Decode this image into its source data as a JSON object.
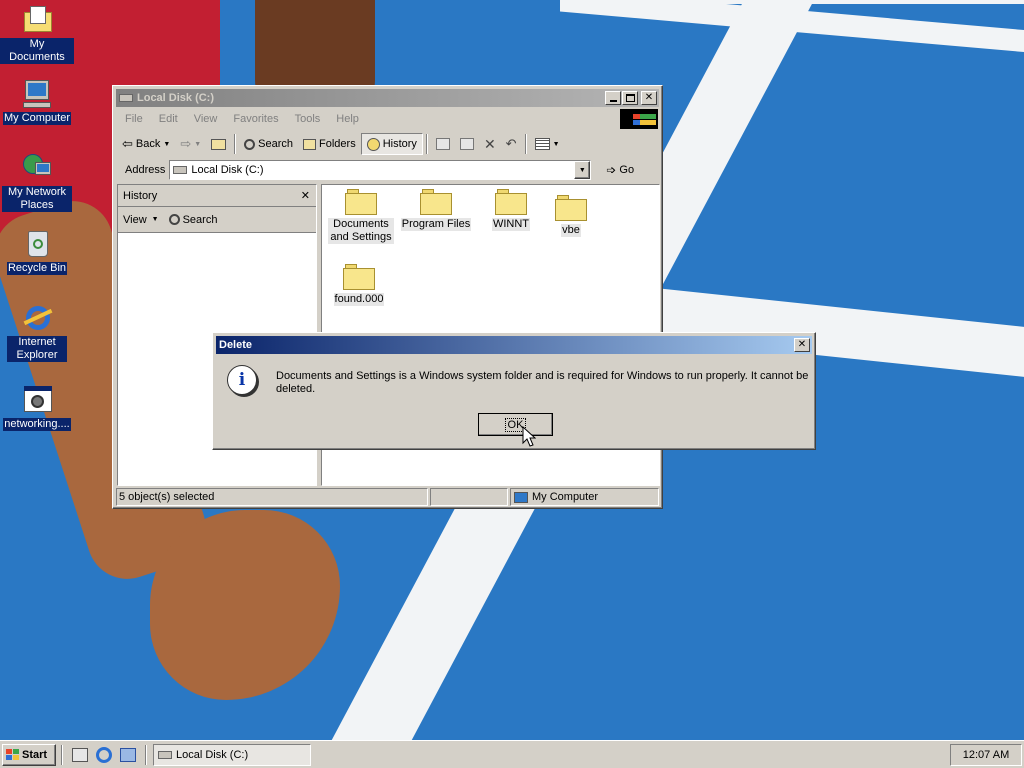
{
  "desktop": {
    "icons": [
      {
        "label": "My Documents",
        "icon": "my-documents-icon"
      },
      {
        "label": "My Computer",
        "icon": "my-computer-icon"
      },
      {
        "label": "My Network Places",
        "icon": "network-places-icon"
      },
      {
        "label": "Recycle Bin",
        "icon": "recycle-bin-icon"
      },
      {
        "label": "Internet Explorer",
        "icon": "internet-explorer-icon"
      },
      {
        "label": "networking....",
        "icon": "program-icon"
      }
    ]
  },
  "explorer": {
    "title": "Local Disk (C:)",
    "menu": [
      "File",
      "Edit",
      "View",
      "Favorites",
      "Tools",
      "Help"
    ],
    "toolbar": {
      "back": "Back",
      "search": "Search",
      "folders": "Folders",
      "history": "History"
    },
    "address": {
      "label": "Address",
      "value": "Local Disk (C:)",
      "go": "Go"
    },
    "history_pane": {
      "title": "History",
      "view": "View",
      "search": "Search"
    },
    "files": [
      {
        "name": "Documents and Settings"
      },
      {
        "name": "Program Files"
      },
      {
        "name": "WINNT"
      },
      {
        "name": "vbe"
      },
      {
        "name": "found.000"
      }
    ],
    "status": {
      "selection": "5 object(s) selected",
      "zone": "My Computer"
    }
  },
  "dialog": {
    "title": "Delete",
    "message": "Documents and Settings is a Windows system folder and is required for Windows to run properly. It cannot be deleted.",
    "ok": "OK",
    "icon": "info-icon"
  },
  "taskbar": {
    "start": "Start",
    "task": "Local Disk (C:)",
    "clock": "12:07 AM"
  }
}
